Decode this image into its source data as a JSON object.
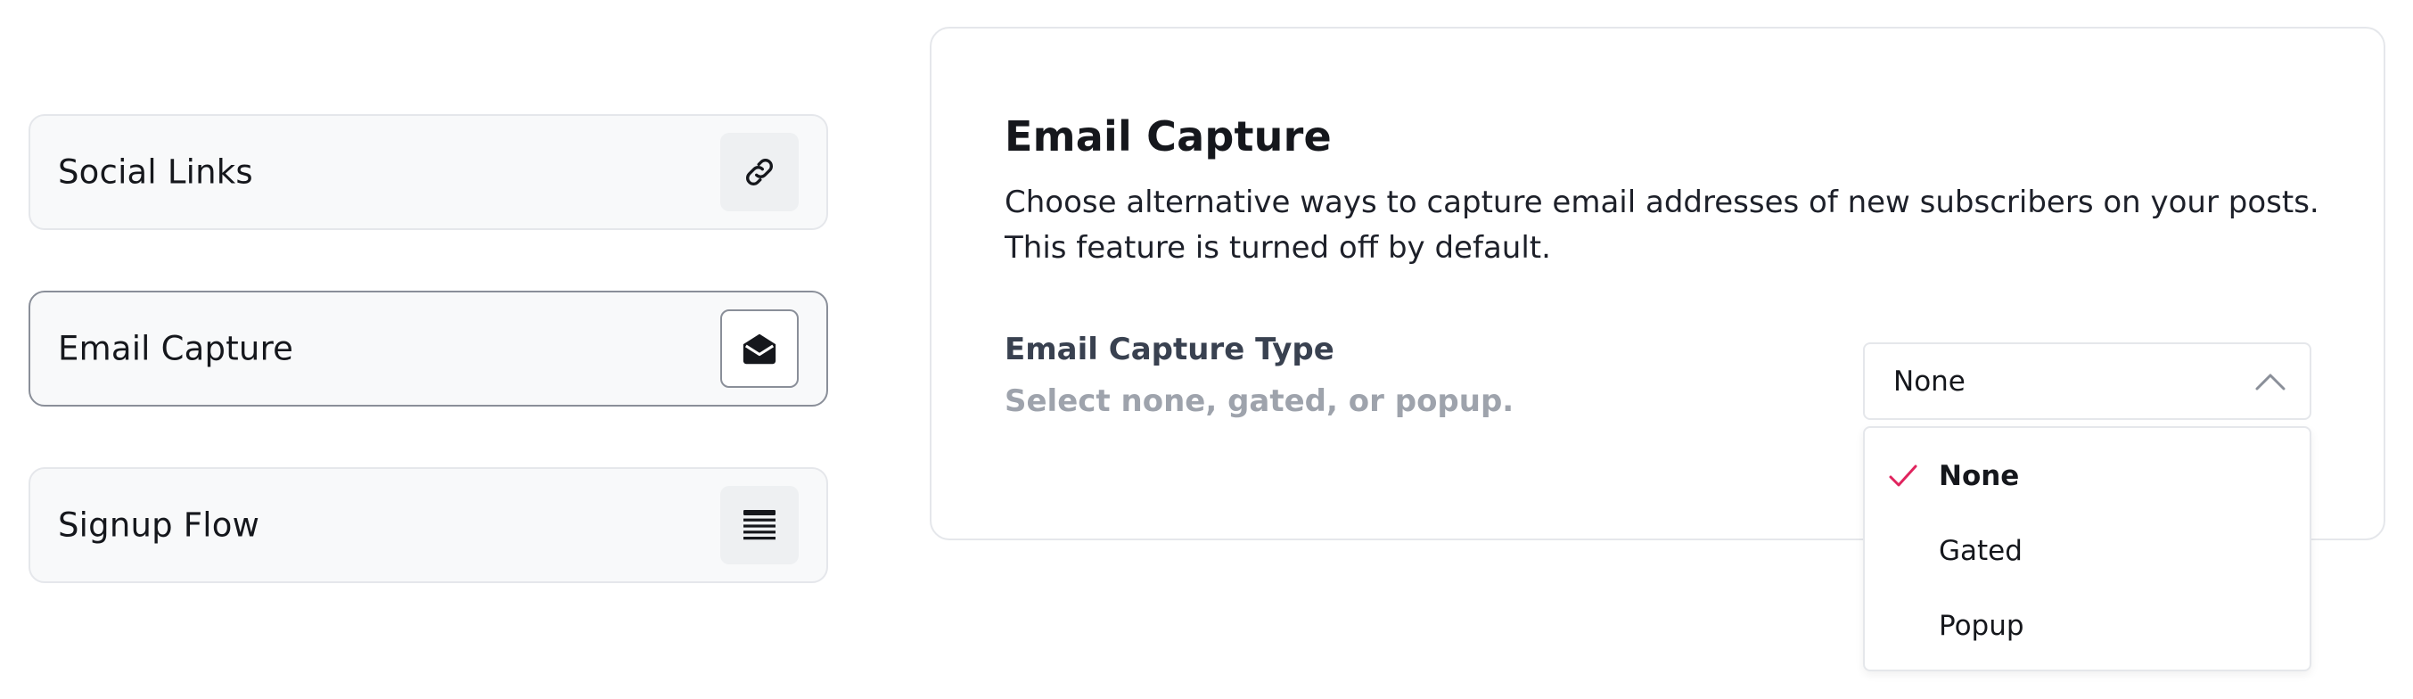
{
  "sidebar": {
    "items": [
      {
        "label": "Social Links",
        "icon": "link-icon",
        "active": false
      },
      {
        "label": "Email Capture",
        "icon": "envelope-open-icon",
        "active": true
      },
      {
        "label": "Signup Flow",
        "icon": "list-lines-icon",
        "active": false
      }
    ]
  },
  "panel": {
    "title": "Email Capture",
    "description": "Choose alternative ways to capture email addresses of new subscribers on your posts. This feature is turned off by default.",
    "field": {
      "label": "Email Capture Type",
      "help": "Select none, gated, or popup.",
      "selected_value": "None",
      "options": [
        {
          "label": "None",
          "selected": true
        },
        {
          "label": "Gated",
          "selected": false
        },
        {
          "label": "Popup",
          "selected": false
        }
      ]
    }
  },
  "colors": {
    "check_accent": "#e0245e",
    "active_border": "#8a8f99"
  }
}
